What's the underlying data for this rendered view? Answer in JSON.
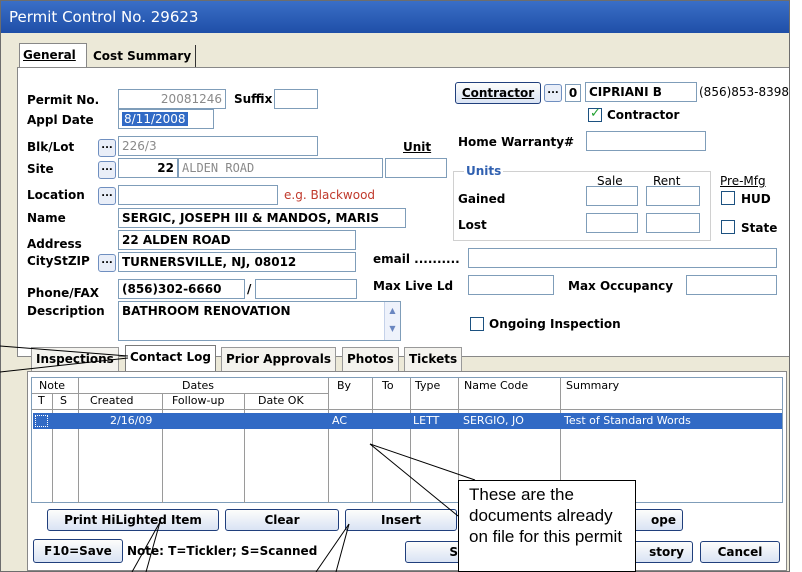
{
  "title": "Permit Control No. 29623",
  "top_tabs": [
    "General",
    "Cost Summary"
  ],
  "permit": {
    "permit_no_label": "Permit No.",
    "permit_no": "20081246",
    "suffix_label": "Suffix",
    "suffix": "",
    "appl_date_label": "Appl Date",
    "appl_date": "8/11/2008",
    "blklot_label": "Blk/Lot",
    "blklot": "226/3",
    "unit_label": "Unit",
    "unit": "",
    "site_label": "Site",
    "site_no": "22",
    "site_street": "ALDEN ROAD",
    "location_label": "Location",
    "location_hint": "e.g. Blackwood",
    "name_label": "Name",
    "name": "SERGIC, JOSEPH III & MANDOS, MARIS",
    "address_label": "Address",
    "address": "22 ALDEN ROAD",
    "citystzip_label": "CityStZIP",
    "citystzip": "TURNERSVILLE, NJ, 08012",
    "phonefax_label": "Phone/FAX",
    "phone": "(856)302-6660",
    "fax_sep": "/",
    "fax": "",
    "description_label": "Description",
    "description": "BATHROOM RENOVATION"
  },
  "contractor": {
    "button": "Contractor",
    "code": "0",
    "name": "CIPRIANI B",
    "phone": "(856)853-8398",
    "checkbox_label": "Contractor",
    "home_warranty_label": "Home Warranty#",
    "home_warranty": ""
  },
  "units": {
    "title": "Units",
    "sale": "Sale",
    "rent": "Rent",
    "gained": "Gained",
    "lost": "Lost",
    "premfg": "Pre-Mfg",
    "hud": "HUD",
    "state": "State"
  },
  "email_label": "email ..........",
  "maxliveld_label": "Max Live Ld",
  "maxocc_label": "Max Occupancy",
  "ongoing_label": "Ongoing Inspection",
  "mid_tabs": [
    "Inspections",
    "Contact Log",
    "Prior Approvals",
    "Photos",
    "Tickets"
  ],
  "grid": {
    "note": "Note",
    "t": "T",
    "s": "S",
    "dates": "Dates",
    "created": "Created",
    "followup": "Follow-up",
    "dateok": "Date OK",
    "by": "By",
    "to": "To",
    "type": "Type",
    "namecode": "Name Code",
    "summary": "Summary",
    "row": {
      "created": "2/16/09",
      "by": "AC",
      "type": "LETT",
      "namecode": "SERGIO, JO",
      "summary": "Test of Standard Words"
    }
  },
  "buttons": {
    "print": "Print HiLighted Item",
    "clear": "Clear",
    "insert": "Insert",
    "ope": "ope",
    "f10": "F10=Save",
    "s": "S",
    "story": "story",
    "cancel": "Cancel"
  },
  "note_text": "Note:  T=Tickler; S=Scanned",
  "callout": "These are the documents already on file for this permit"
}
